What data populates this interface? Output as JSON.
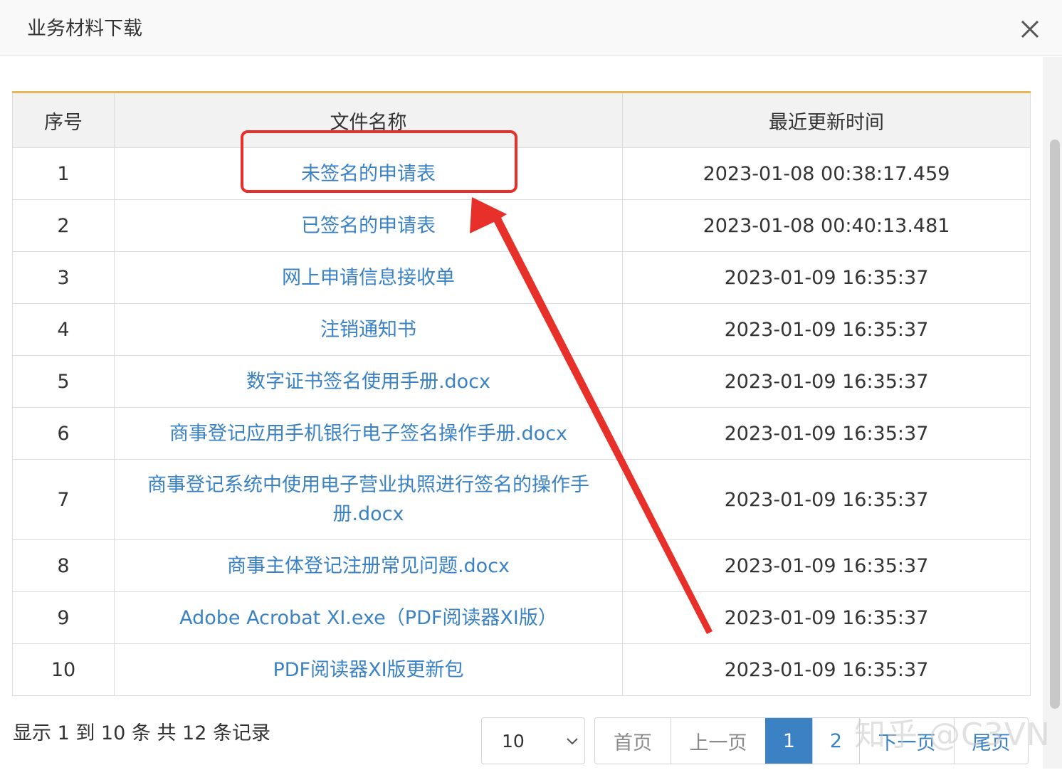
{
  "dialog": {
    "title": "业务材料下载"
  },
  "table": {
    "headers": [
      "序号",
      "文件名称",
      "最近更新时间"
    ],
    "rows": [
      {
        "index": "1",
        "name": "未签名的申请表",
        "updated": "2023-01-08 00:38:17.459"
      },
      {
        "index": "2",
        "name": "已签名的申请表",
        "updated": "2023-01-08 00:40:13.481"
      },
      {
        "index": "3",
        "name": "网上申请信息接收单",
        "updated": "2023-01-09 16:35:37"
      },
      {
        "index": "4",
        "name": "注销通知书",
        "updated": "2023-01-09 16:35:37"
      },
      {
        "index": "5",
        "name": "数字证书签名使用手册.docx",
        "updated": "2023-01-09 16:35:37"
      },
      {
        "index": "6",
        "name": "商事登记应用手机银行电子签名操作手册.docx",
        "updated": "2023-01-09 16:35:37"
      },
      {
        "index": "7",
        "name": "商事登记系统中使用电子营业执照进行签名的操作手册.docx",
        "updated": "2023-01-09 16:35:37"
      },
      {
        "index": "8",
        "name": "商事主体登记注册常见问题.docx",
        "updated": "2023-01-09 16:35:37"
      },
      {
        "index": "9",
        "name": "Adobe Acrobat XI.exe（PDF阅读器XI版）",
        "updated": "2023-01-09 16:35:37"
      },
      {
        "index": "10",
        "name": "PDF阅读器XI版更新包",
        "updated": "2023-01-09 16:35:37"
      }
    ]
  },
  "footer": {
    "info": "显示 1 到 10 条 共 12 条记录",
    "page_size": "10",
    "pagination": {
      "first": "首页",
      "prev": "上一页",
      "pages": [
        "1",
        "2"
      ],
      "current_page": "1",
      "next": "下一页",
      "last": "尾页"
    }
  },
  "watermark": "知乎 @C3VN",
  "colors": {
    "link": "#3a82c4",
    "header_accent": "#e8b65a",
    "annotation": "#e8302a",
    "active_page": "#3a82c4"
  },
  "icons": {
    "close": "close-icon",
    "dropdown": "chevron-down-icon"
  }
}
